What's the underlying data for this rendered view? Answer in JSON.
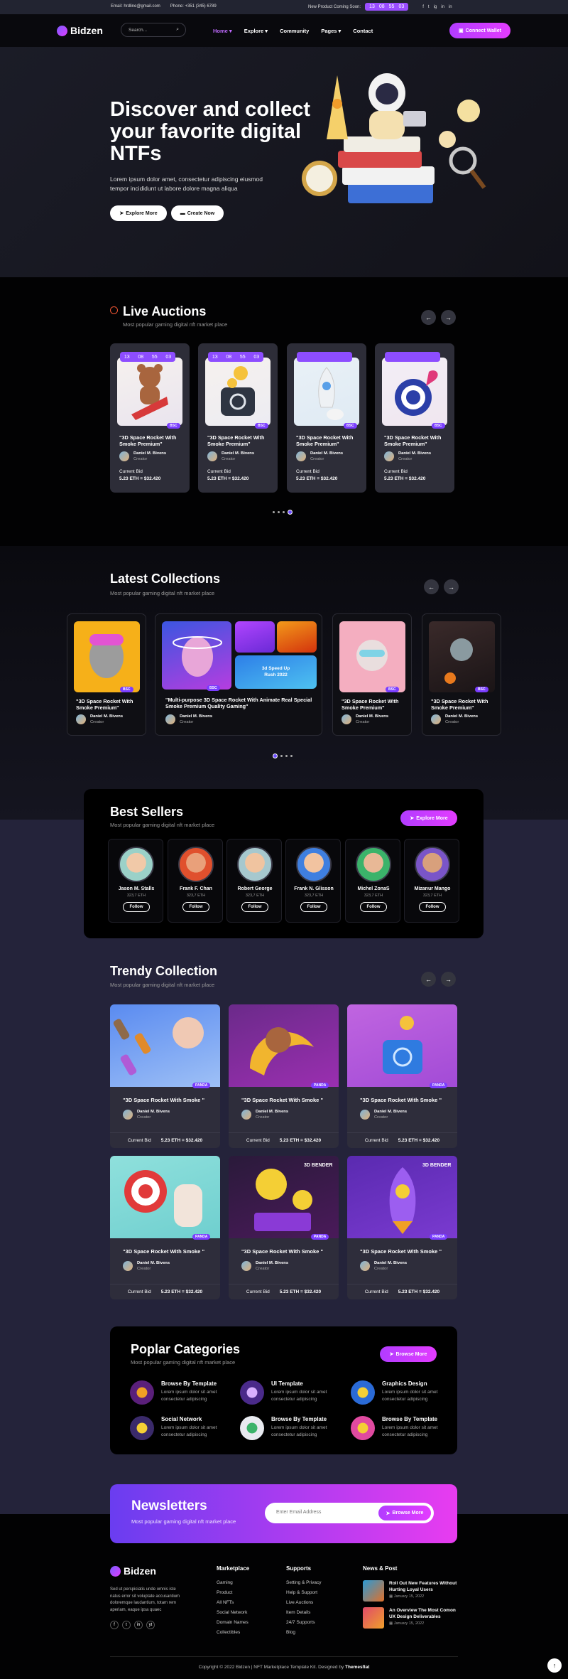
{
  "topbar": {
    "email": "Email: hrdline@gmail.com",
    "phone": "Phone: +351 (345) 6789",
    "coming": "New Product Coming Soon:",
    "timer": [
      "13",
      "08",
      "55",
      "03"
    ],
    "social": [
      "f",
      "t",
      "ig",
      "in",
      "in"
    ]
  },
  "header": {
    "brand": "Bidzen",
    "search_placeholder": "Search...",
    "nav": [
      "Home",
      "Explore",
      "Community",
      "Pages",
      "Contact"
    ],
    "connect": "Connect Wallet"
  },
  "hero": {
    "title": "Discover and collect your favorite digital NTFs",
    "desc": "Lorem ipsum dolor amet, consectetur adipiscing eiusmod tempor incididunt ut labore dolore magna aliqua",
    "btn1": "Explore More",
    "btn2": "Create Now"
  },
  "live": {
    "title": "Live Auctions",
    "sub": "Most popular gaming digital nft market place",
    "timer": [
      "13",
      "08",
      "55",
      "03"
    ],
    "badge": "BSC",
    "cards": [
      {
        "title": "\"3D Space Rocket With Smoke Premium\"",
        "creator": "Daniel M. Bivens",
        "role": "Creator",
        "bid_label": "Current Bid",
        "bid": "5.23 ETH = $32.420",
        "timer": true
      },
      {
        "title": "\"3D Space Rocket With Smoke Premium\"",
        "creator": "Daniel M. Bivens",
        "role": "Creator",
        "bid_label": "Current Bid",
        "bid": "5.23 ETH = $32.420",
        "timer": true
      },
      {
        "title": "\"3D Space Rocket With Smoke Premium\"",
        "creator": "Daniel M. Bivens",
        "role": "Creator",
        "bid_label": "Current Bid",
        "bid": "5.23 ETH = $32.420",
        "timer": false
      },
      {
        "title": "\"3D Space Rocket With Smoke Premium\"",
        "creator": "Daniel M. Bivens",
        "role": "Creator",
        "bid_label": "Current Bid",
        "bid": "5.23 ETH = $32.420",
        "timer": false
      }
    ]
  },
  "latest": {
    "title": "Latest Collections",
    "sub": "Most popular gaming digital nft market place",
    "badge": "BSC",
    "cards": [
      {
        "title": "\"3D Space Rocket With Smoke Premium\"",
        "creator": "Daniel M. Bivens",
        "role": "Creator"
      },
      {
        "title": "\"Multi-purpose 3D Space Rocket With Animate Real Special Smoke Premium Quality Gaming\"",
        "creator": "Daniel M. Bivens",
        "role": "Creator",
        "tag1": "3d Speed Up",
        "tag2": "Rush 2022"
      },
      {
        "title": "\"3D Space Rocket With Smoke Premium\"",
        "creator": "Daniel M. Bivens",
        "role": "Creator"
      },
      {
        "title": "\"3D Space Rocket With Smoke Premium\"",
        "creator": "Daniel M. Bivens",
        "role": "Creator"
      }
    ]
  },
  "sellers": {
    "title": "Best Sellers",
    "sub": "Most popular gaming digital nft market place",
    "btn": "Explore More",
    "follow": "Follow",
    "items": [
      {
        "name": "Jason M. Stalls",
        "eth": "323,7 ETH"
      },
      {
        "name": "Frank F. Chan",
        "eth": "323,7 ETH"
      },
      {
        "name": "Robert George",
        "eth": "323,7 ETH"
      },
      {
        "name": "Frank N. Glisson",
        "eth": "323,7 ETH"
      },
      {
        "name": "Michel ZonaS",
        "eth": "323,7 ETH"
      },
      {
        "name": "Mizanur Mango",
        "eth": "323,7 ETH"
      }
    ]
  },
  "trendy": {
    "title": "Trendy Collection",
    "sub": "Most popular gaming digital nft market place",
    "badge": "PANDA",
    "bender": "3D BENDER",
    "cards": [
      {
        "title": "\"3D Space Rocket With Smoke \"",
        "creator": "Daniel M. Bivens",
        "role": "Creator",
        "bid_label": "Current Bid",
        "bid": "5.23 ETH = $32.420"
      },
      {
        "title": "\"3D Space Rocket With Smoke \"",
        "creator": "Daniel M. Bivens",
        "role": "Creator",
        "bid_label": "Current Bid",
        "bid": "5.23 ETH = $32.420"
      },
      {
        "title": "\"3D Space Rocket With Smoke \"",
        "creator": "Daniel M. Bivens",
        "role": "Creator",
        "bid_label": "Current Bid",
        "bid": "5.23 ETH = $32.420"
      },
      {
        "title": "\"3D Space Rocket With Smoke \"",
        "creator": "Daniel M. Bivens",
        "role": "Creator",
        "bid_label": "Current Bid",
        "bid": "5.23 ETH = $32.420"
      },
      {
        "title": "\"3D Space Rocket With Smoke \"",
        "creator": "Daniel M. Bivens",
        "role": "Creator",
        "bid_label": "Current Bid",
        "bid": "5.23 ETH = $32.420"
      },
      {
        "title": "\"3D Space Rocket With Smoke \"",
        "creator": "Daniel M. Bivens",
        "role": "Creator",
        "bid_label": "Current Bid",
        "bid": "5.23 ETH = $32.420"
      }
    ]
  },
  "categories": {
    "title": "Poplar Categories",
    "sub": "Most popular gaming digital nft market place",
    "btn": "Browse More",
    "items": [
      {
        "name": "Browse By Template",
        "desc": "Lorem ipsum dolor sit amet consectetur adipiscing"
      },
      {
        "name": "UI Template",
        "desc": "Lorem ipsum dolor sit amet consectetur adipiscing"
      },
      {
        "name": "Graphics Design",
        "desc": "Lorem ipsum dolor sit amet consectetur adipiscing"
      },
      {
        "name": "Social Network",
        "desc": "Lorem ipsum dolor sit amet consectetur adipiscing"
      },
      {
        "name": "Browse By Template",
        "desc": "Lorem ipsum dolor sit amet consectetur adipiscing"
      },
      {
        "name": "Browse By Template",
        "desc": "Lorem ipsum dolor sit amet consectetur adipiscing"
      }
    ]
  },
  "newsletter": {
    "title": "Newsletters",
    "sub": "Most popular gaming digital nft market place",
    "placeholder": "Enter Email Address",
    "btn": "Browse More"
  },
  "footer": {
    "brand": "Bidzen",
    "about": "Sed ut perspiciatis unde omnis iste natus error sit voluptate accusantium doloremque laudantium, totam rem aperiam, eaque ipsa quaec",
    "social": [
      "f",
      "t",
      "in",
      "yt"
    ],
    "col1": {
      "title": "Marketplace",
      "items": [
        "Gaming",
        "Product",
        "All NFTs",
        "Social Network",
        "Domain Names",
        "Collectibles"
      ]
    },
    "col2": {
      "title": "Supports",
      "items": [
        "Setting & Privacy",
        "Help & Support",
        "Live Auctions",
        "Item Details",
        "24/7 Supports",
        "Blog"
      ]
    },
    "news": {
      "title": "News & Post",
      "items": [
        {
          "title": "Roll Out New Features Without Hurting Loyal Users",
          "date": "January 15, 2022"
        },
        {
          "title": "An Overview The Most Comon UX Design Deliverables",
          "date": "January 15, 2022"
        }
      ]
    },
    "copyright": "Copyright © 2022 Bidzen | NFT Marketplace Template Kit. Designed by ",
    "designer": "Themesflat"
  }
}
